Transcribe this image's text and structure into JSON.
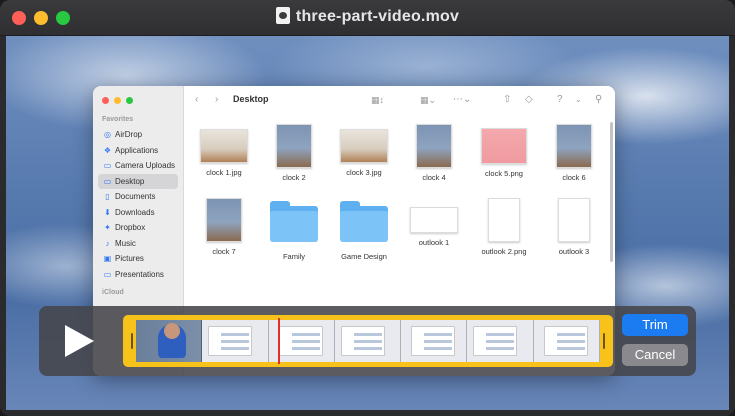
{
  "window": {
    "title": "three-part-video.mov",
    "buttons": [
      "close",
      "minimize",
      "zoom"
    ]
  },
  "finder": {
    "location": "Desktop",
    "sidebar": {
      "favorites_heading": "Favorites",
      "items": [
        {
          "label": "AirDrop",
          "icon": "airdrop-icon",
          "selected": false
        },
        {
          "label": "Applications",
          "icon": "applications-icon",
          "selected": false
        },
        {
          "label": "Camera Uploads",
          "icon": "folder-icon",
          "selected": false
        },
        {
          "label": "Desktop",
          "icon": "desktop-icon",
          "selected": true
        },
        {
          "label": "Documents",
          "icon": "document-icon",
          "selected": false
        },
        {
          "label": "Downloads",
          "icon": "downloads-icon",
          "selected": false
        },
        {
          "label": "Dropbox",
          "icon": "dropbox-icon",
          "selected": false
        },
        {
          "label": "Music",
          "icon": "music-icon",
          "selected": false
        },
        {
          "label": "Pictures",
          "icon": "pictures-icon",
          "selected": false
        },
        {
          "label": "Presentations",
          "icon": "folder-icon",
          "selected": false
        }
      ],
      "icloud_heading": "iCloud"
    },
    "files": [
      {
        "name": "clock 1.jpg",
        "kind": "photo"
      },
      {
        "name": "clock 2",
        "kind": "portrait"
      },
      {
        "name": "clock 3.jpg",
        "kind": "photo"
      },
      {
        "name": "clock 4",
        "kind": "portrait"
      },
      {
        "name": "clock 5.png",
        "kind": "photo-pink"
      },
      {
        "name": "clock 6",
        "kind": "portrait"
      },
      {
        "name": "clock 7",
        "kind": "portrait"
      },
      {
        "name": "Family",
        "kind": "folder"
      },
      {
        "name": "Game Design",
        "kind": "folder"
      },
      {
        "name": "outlook 1",
        "kind": "doc-wide"
      },
      {
        "name": "outlook 2.png",
        "kind": "doc"
      },
      {
        "name": "outlook 3",
        "kind": "doc"
      }
    ]
  },
  "trim": {
    "play_icon": "play-icon",
    "trim_label": "Trim",
    "cancel_label": "Cancel",
    "accent": "#f7c31a",
    "playhead_color": "#e0302a"
  }
}
